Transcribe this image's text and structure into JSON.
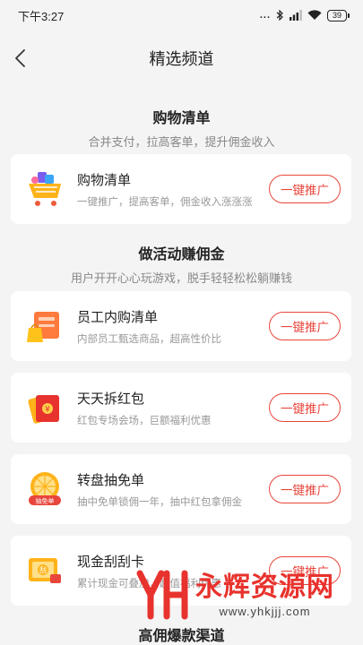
{
  "status": {
    "time": "下午3:27",
    "dots": "...",
    "battery": "39"
  },
  "nav": {
    "title": "精选频道"
  },
  "sections": [
    {
      "title": "购物清单",
      "subtitle": "合并支付，拉高客单，提升佣金收入"
    },
    {
      "title": "做活动赚佣金",
      "subtitle": "用户开开心心玩游戏，脱手轻轻松松躺赚钱"
    }
  ],
  "cards": [
    {
      "title": "购物清单",
      "desc": "一键推广，提高客单，佣金收入涨涨涨",
      "button": "一键推广",
      "icon": "shopping-cart-icon"
    },
    {
      "title": "员工内购清单",
      "desc": "内部员工甄选商品，超高性价比",
      "button": "一键推广",
      "icon": "shopping-bag-icon"
    },
    {
      "title": "天天拆红包",
      "desc": "红包专场会场，巨额福利优惠",
      "button": "一键推广",
      "icon": "red-envelope-icon"
    },
    {
      "title": "转盘抽免单",
      "desc": "抽中免单锁佣一年，抽中红包拿佣金",
      "button": "一键推广",
      "icon": "lucky-wheel-icon",
      "badge": "抽免单"
    },
    {
      "title": "现金刮刮卡",
      "desc": "累计现金可叠加，超值福利优惠",
      "button": "一键推广",
      "icon": "scratch-card-icon",
      "badge": "刮"
    }
  ],
  "bottom_section": {
    "title": "高佣爆款渠道"
  },
  "watermark": {
    "name": "永辉资源网",
    "url": "www.yhkjjj.com"
  },
  "colors": {
    "accent": "#e8453c",
    "background": "#f4f4f4",
    "card": "#ffffff"
  }
}
